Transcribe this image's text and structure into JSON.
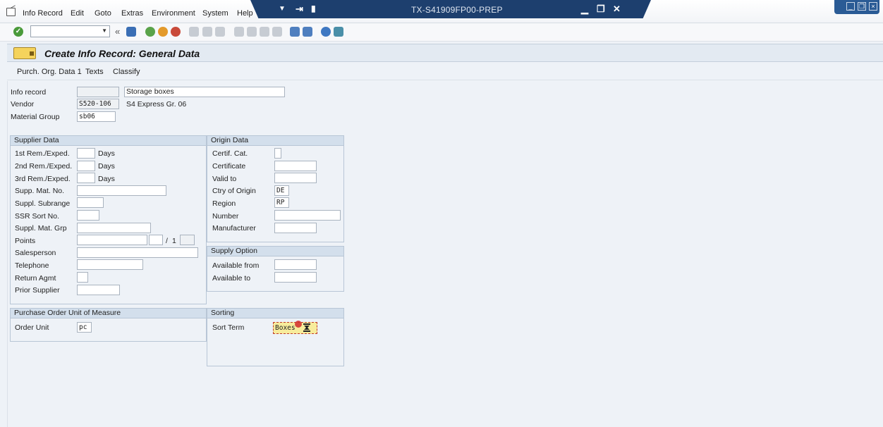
{
  "menu": [
    "Info Record",
    "Edit",
    "Goto",
    "Extras",
    "Environment",
    "System",
    "Help"
  ],
  "window": {
    "title": "TX-S41909FP00-PREP"
  },
  "colors": {
    "title_bar": "#1d3f6e",
    "group_header": "#d3dfec",
    "highlight_field": "#f7ec9c",
    "ok_green": "#4a9a3a"
  },
  "toolbar": {
    "ok_glyph": "✓",
    "back_glyph": "«"
  },
  "header": {
    "title": "Create Info Record: General Data"
  },
  "app_toolbar": [
    "Purch. Org. Data 1",
    "Texts",
    "Classify"
  ],
  "top": {
    "info_record_label": "Info record",
    "info_record_value": "",
    "info_record_text": "Storage boxes",
    "vendor_label": "Vendor",
    "vendor_value": "S520-106",
    "vendor_name": "S4 Express Gr. 06",
    "material_group_label": "Material Group",
    "material_group_value": "sb06"
  },
  "supplier": {
    "title": "Supplier Data",
    "rem1_label": "1st Rem./Exped.",
    "rem2_label": "2nd Rem./Exped.",
    "rem3_label": "3rd Rem./Exped.",
    "days": "Days",
    "supp_mat_no_label": "Supp. Mat. No.",
    "subrange_label": "Suppl. Subrange",
    "ssr_label": "SSR Sort No.",
    "mat_grp_label": "Suppl. Mat. Grp",
    "points_label": "Points",
    "points_sep": "/",
    "points_per": "1",
    "salesperson_label": "Salesperson",
    "telephone_label": "Telephone",
    "return_label": "Return Agmt",
    "prior_label": "Prior Supplier"
  },
  "origin": {
    "title": "Origin Data",
    "certif_cat_label": "Certif. Cat.",
    "certificate_label": "Certificate",
    "valid_to_label": "Valid to",
    "ctry_label": "Ctry of Origin",
    "ctry_value": "DE",
    "region_label": "Region",
    "region_value": "RP",
    "number_label": "Number",
    "manufacturer_label": "Manufacturer"
  },
  "supply": {
    "title": "Supply Option",
    "from_label": "Available from",
    "to_label": "Available to"
  },
  "uom": {
    "title": "Purchase Order Unit of Measure",
    "order_unit_label": "Order Unit",
    "order_unit_value": "pc"
  },
  "sorting": {
    "title": "Sorting",
    "sort_term_label": "Sort Term",
    "sort_term_value": "Boxes"
  }
}
